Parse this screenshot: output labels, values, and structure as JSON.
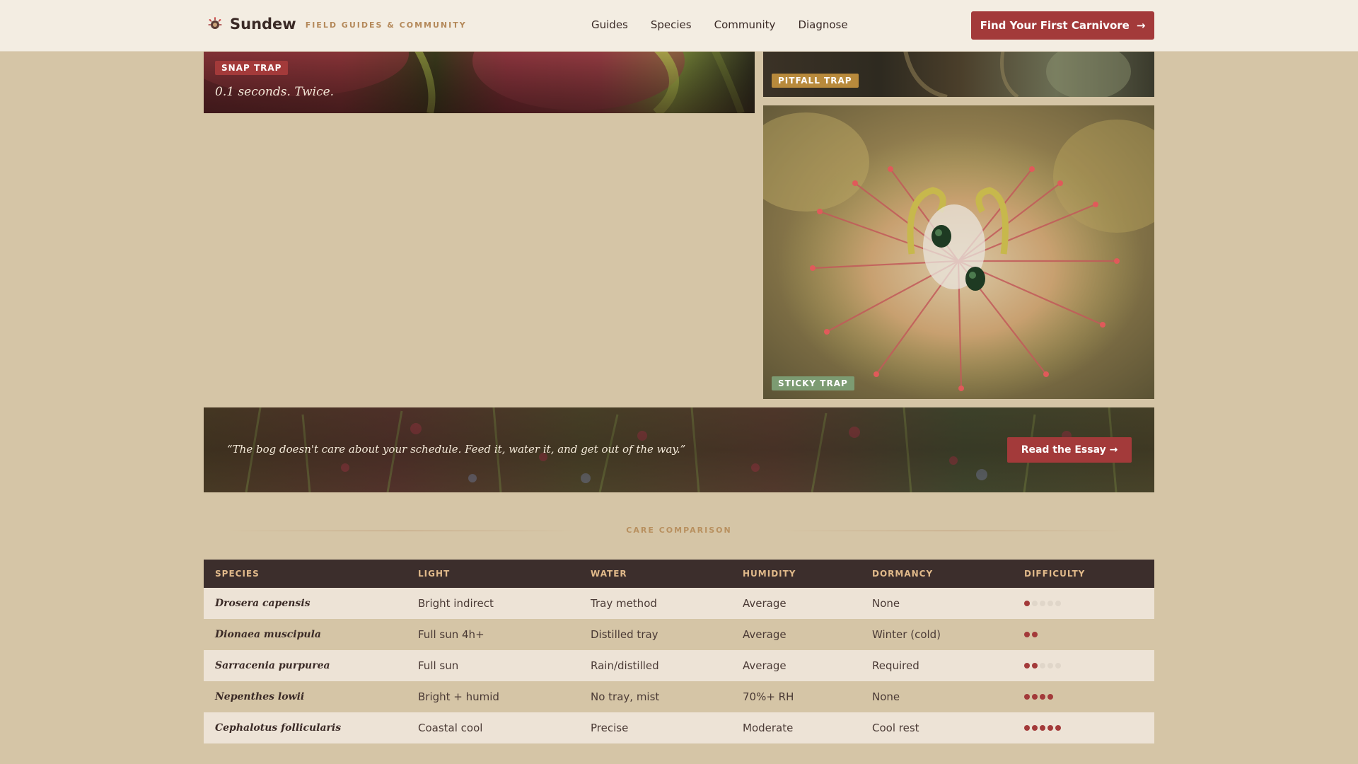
{
  "header": {
    "brand_name": "Sundew",
    "brand_tagline": "FIELD GUIDES & COMMUNITY",
    "nav": [
      "Guides",
      "Species",
      "Community",
      "Diagnose"
    ],
    "cta_label": "Find Your First Carnivore",
    "cta_arrow": "→"
  },
  "cards": {
    "snap": {
      "badge": "SNAP TRAP",
      "caption": "0.1 seconds. Twice."
    },
    "pitfall": {
      "badge": "PITFALL TRAP"
    },
    "sticky": {
      "badge": "STICKY TRAP"
    }
  },
  "banner": {
    "quote": "“The bog doesn't care about your schedule. Feed it, water it, and get out of the way.”",
    "button_label": "Read the Essay →"
  },
  "care": {
    "section_title": "CARE COMPARISON",
    "columns": [
      "SPECIES",
      "LIGHT",
      "WATER",
      "HUMIDITY",
      "DORMANCY",
      "DIFFICULTY"
    ],
    "rows": [
      {
        "species": "Drosera capensis",
        "light": "Bright indirect",
        "water": "Tray method",
        "humidity": "Average",
        "dormancy": "None",
        "difficulty": 1,
        "difficulty_of": 5
      },
      {
        "species": "Dionaea muscipula",
        "light": "Full sun 4h+",
        "water": "Distilled tray",
        "humidity": "Average",
        "dormancy": "Winter (cold)",
        "difficulty": 2,
        "difficulty_of": 2
      },
      {
        "species": "Sarracenia purpurea",
        "light": "Full sun",
        "water": "Rain/distilled",
        "humidity": "Average",
        "dormancy": "Required",
        "difficulty": 2,
        "difficulty_of": 5
      },
      {
        "species": "Nepenthes lowii",
        "light": "Bright + humid",
        "water": "No tray, mist",
        "humidity": "70%+ RH",
        "dormancy": "None",
        "difficulty": 4,
        "difficulty_of": 4
      },
      {
        "species": "Cephalotus follicularis",
        "light": "Coastal cool",
        "water": "Precise",
        "humidity": "Moderate",
        "dormancy": "Cool rest",
        "difficulty": 5,
        "difficulty_of": 5
      }
    ]
  },
  "colors": {
    "accent": "#a33a3a",
    "snap_badge": "#a33a3a",
    "pitfall_badge": "#b88a3c",
    "sticky_badge": "#7c9b72",
    "page_bg": "#d5c5a6"
  },
  "icons": {
    "brand": "sundew-logo-icon"
  }
}
